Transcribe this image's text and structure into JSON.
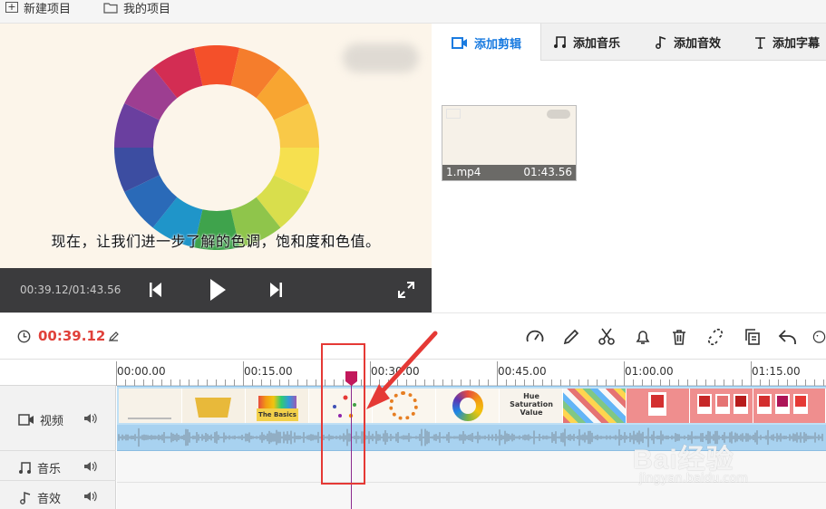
{
  "topbar": {
    "new_project": "新建项目",
    "my_projects": "我的项目"
  },
  "preview": {
    "subtitle": "现在，让我们进一步了解的色调，饱和度和色值。"
  },
  "player": {
    "time": "00:39.12/01:43.56"
  },
  "tabs": [
    {
      "label": "添加剪辑",
      "icon": "video-icon",
      "active": true
    },
    {
      "label": "添加音乐",
      "icon": "music-note-icon",
      "active": false
    },
    {
      "label": "添加音效",
      "icon": "sound-effect-icon",
      "active": false
    },
    {
      "label": "添加字幕",
      "icon": "text-icon",
      "active": false
    }
  ],
  "library": {
    "clip": {
      "name": "1.mp4",
      "duration": "01:43.56"
    }
  },
  "timeline": {
    "current_time": "00:39.12",
    "ruler": [
      "00:00.00",
      "00:15.00",
      "00:30.00",
      "00:45.00",
      "01:00.00",
      "01:15.00"
    ],
    "tracks": {
      "video": "视频",
      "music": "音乐",
      "sfx": "音效"
    },
    "frame_texts": {
      "basics": "The Basics",
      "hsv": "Hue\nSaturation\nValue"
    }
  },
  "watermark": {
    "brand": "Bai经验",
    "url": "jingyan.baidu.com"
  },
  "colors": {
    "accent": "#1a7be0",
    "time_red": "#e0413a",
    "playhead": "#8b2a8e",
    "highlight": "#e53935"
  }
}
